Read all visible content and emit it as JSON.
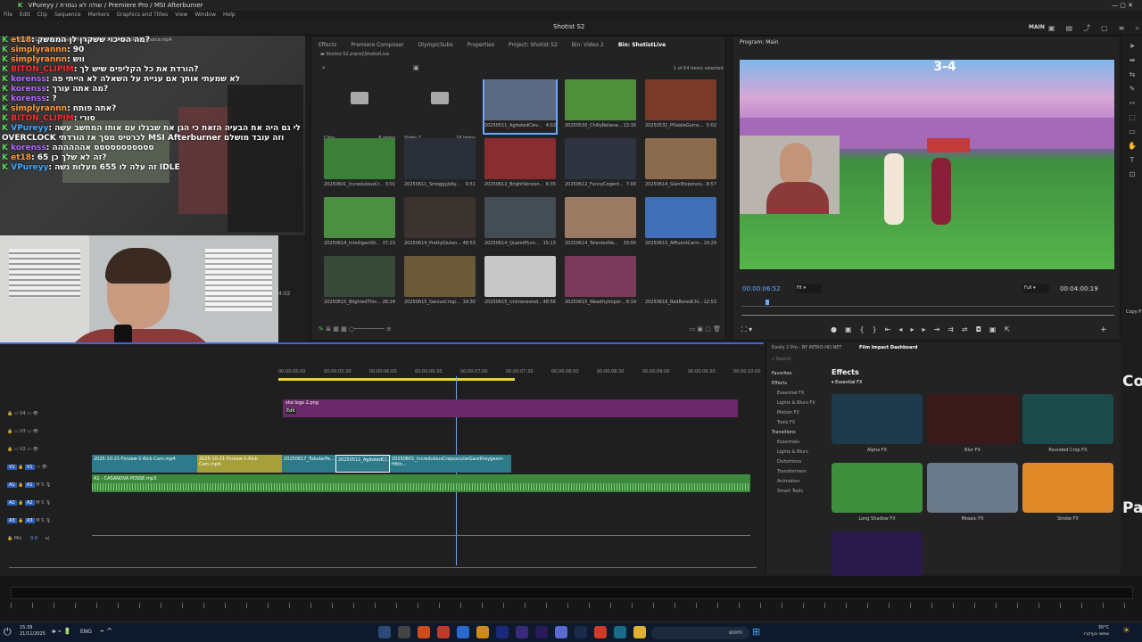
{
  "window": {
    "title": "VPureyy / שולה לא נגמרת / Premiere Pro / MSI Afterburner",
    "sequence_title": "Shotist S2",
    "workspace": "MAIN"
  },
  "menu": [
    "File",
    "Edit",
    "Clip",
    "Sequence",
    "Markers",
    "Graphics and Titles",
    "View",
    "Window",
    "Help"
  ],
  "chat": {
    "header_file": "20250511_AgitatedCleverPiedCWarrior-3i3D9pPLlidRZdt_source.mp4",
    "lines": [
      {
        "user": "et18",
        "text": ": מה הסיכוי ששקרן לן הממשק?",
        "color": "#ff9a3c"
      },
      {
        "user": "simplyrannn",
        "text": ": 90",
        "color": "#ff9a3c"
      },
      {
        "user": "simplyrannn",
        "text": ": ווש",
        "color": "#ff9a3c"
      },
      {
        "user": "BITON_CLIPIM",
        "text": ": הורדת את כל הקליפים שיש לך?",
        "color": "#ff2a2a"
      },
      {
        "user": "korenss",
        "text": ": לא שמעתי אותך אם עניית על השאלה לא הייתי פה",
        "color": "#b36bff"
      },
      {
        "user": "korenss",
        "text": ": מה אתה עורך?",
        "color": "#b36bff"
      },
      {
        "user": "korenss",
        "text": ": ?",
        "color": "#b36bff"
      },
      {
        "user": "simplyrannn",
        "text": ": אתה פותח?",
        "color": "#ff9a3c"
      },
      {
        "user": "BITON_CLIPIM",
        "text": ": סורי",
        "color": "#ff2a2a"
      },
      {
        "user": "VPureyy",
        "text": ": לי גם היה את הבעיה הזאת כי הגן את שבגלו עם אותו המחשב עשה",
        "color": "#3fa9ff"
      },
      {
        "user": "",
        "text": "OVERCLOCK לכרטיס מסך אז הורדתי MSI Afterburner וזה עובד מושלם",
        "color": "#ffffff"
      },
      {
        "user": "korenss",
        "text": ": ססססססססססס אהההההה",
        "color": "#b36bff"
      },
      {
        "user": "et18",
        "text": ": 65 זה לא שלך כן?",
        "color": "#ff9a3c"
      },
      {
        "user": "VPureyy",
        "text": ": זה עלה לו 655 מעלות נשה IDLE",
        "color": "#3fa9ff"
      }
    ]
  },
  "project": {
    "tabs": [
      "Effects",
      "Premiere Composer",
      "OlympicSubs",
      "Properties",
      "Project: Shotist S2",
      "Bin: Video 2",
      "Bin: ShotistLive"
    ],
    "active_tab": "Bin: ShotistLive",
    "path": "Shotist S2.prproj\\ShotistLive",
    "selection_info": "1 of 64 items selected",
    "items": [
      {
        "name": "Clips",
        "dur": "6 items",
        "kind": "folder"
      },
      {
        "name": "Video 2",
        "dur": "16 items",
        "kind": "folder"
      },
      {
        "name": "20250511_AgitatedClev...",
        "dur": "4:02",
        "kind": "clip",
        "color": "#5b6a82"
      },
      {
        "name": "20250530_ChillyRelieve...",
        "dur": "13:16",
        "kind": "clip",
        "color": "#4f8f3a"
      },
      {
        "name": "20250531_PlliableGurns...",
        "dur": "5:02",
        "kind": "clip",
        "color": "#7a3a2a"
      },
      {
        "name": "20250601_IncredulousCr...",
        "dur": "3:01",
        "kind": "clip",
        "color": "#3c7f38"
      },
      {
        "name": "20250611_SmoggyJolly...",
        "dur": "9:51",
        "kind": "clip",
        "color": "#2a2f3a"
      },
      {
        "name": "20250612_BrightVersion...",
        "dur": "6:35",
        "kind": "clip",
        "color": "#8a2d33"
      },
      {
        "name": "20250612_FunnyCogent...",
        "dur": "7:00",
        "kind": "clip",
        "color": "#2e3440"
      },
      {
        "name": "20250614_GiantExpensiv...",
        "dur": "8:57",
        "kind": "clip",
        "color": "#8a6b4e"
      },
      {
        "name": "20250614_IntelligentSt...",
        "dur": "37:23",
        "kind": "clip",
        "color": "#4c8f42"
      },
      {
        "name": "20250614_PrettyGluten...",
        "dur": "48:53",
        "kind": "clip",
        "color": "#3a3330"
      },
      {
        "name": "20250614_QuaintPlum...",
        "dur": "15:13",
        "kind": "clip",
        "color": "#444c55"
      },
      {
        "name": "20250614_TalentedVe...",
        "dur": "33:00",
        "kind": "clip",
        "color": "#9a7a62"
      },
      {
        "name": "20250615_AffluentCarin...",
        "dur": "19:29",
        "kind": "clip",
        "color": "#3f6fb6"
      },
      {
        "name": "20250615_BlightedThin...",
        "dur": "26:24",
        "kind": "clip",
        "color": "#3a4a3a"
      },
      {
        "name": "20250615_GeniusCrisp...",
        "dur": "19:30",
        "kind": "clip",
        "color": "#6a5a3a"
      },
      {
        "name": "20250615_Uninterested...",
        "dur": "48:56",
        "kind": "clip",
        "color": "#c8c8c8"
      },
      {
        "name": "20250615_WealthyImpor...",
        "dur": "8:19",
        "kind": "clip",
        "color": "#7a3a5a"
      },
      {
        "name": "20250616_RedBoredChi...",
        "dur": "12:53",
        "kind": "clip",
        "color": "#222222"
      }
    ]
  },
  "program": {
    "title": "Program: Main",
    "timecode": "00:00:06:52",
    "fit": "Fit",
    "quality": "Full",
    "duration": "00:04:00:19",
    "scoreboard": "3-4"
  },
  "timeline": {
    "ruler": [
      "00:00:05:00",
      "00:00:05:30",
      "00:00:06:00",
      "00:00:06:30",
      "00:00:07:00",
      "00:00:07:30",
      "00:00:08:00",
      "00:00:08:30",
      "00:00:09:00",
      "00:00:09:30",
      "00:00:10:00"
    ],
    "tracks_video": [
      "V4",
      "V3",
      "V2",
      "V1"
    ],
    "tracks_audio": [
      "A1",
      "A2",
      "A3"
    ],
    "mix_label": "Mix",
    "mix_value": "0.0",
    "graphic_clip": "sho logo 2.png",
    "graphic_tag": "Edit",
    "v1_clips": [
      "2025-10-21-Forzaw-1-Kick-Cam.mp4",
      "2025-10-21-Forzaw-1-Kick-Cam.mp4",
      "20250617_TubularPa...",
      "20250511_AgitatedCl...",
      "20250601_IncredulousCrepuscularGaurKreygasm-HItIn..."
    ],
    "a1_clip": "A1 - CASANOVA POSSE.mp3",
    "side_timecode": "4:02"
  },
  "effects_panel": {
    "tabs": [
      "Easily 2 Pro - BY INTRO-HD.NET",
      "Film Impact Dashboard"
    ],
    "search_placeholder": "Search",
    "heading": "Effects",
    "breadcrumb": "Essential FX",
    "sidebar": [
      "Favorites",
      "Effects",
      "Essential FX",
      "Lights & Blurs FX",
      "Motion FX",
      "Tools FX",
      "Transitions",
      "Essentials",
      "Lights & Blurs",
      "Distortions",
      "Transformers",
      "Animation",
      "Smart Tools"
    ],
    "items": [
      {
        "name": "Alpha FX",
        "color": "#1f3a4a"
      },
      {
        "name": "Blur FX",
        "color": "#3a1a1a"
      },
      {
        "name": "Rounded Crop FX",
        "color": "#1d4a4a"
      },
      {
        "name": "Long Shadow FX",
        "color": "#3e8f3e"
      },
      {
        "name": "Mosaic FX",
        "color": "#6a7a8a"
      },
      {
        "name": "Stroke FX",
        "color": "#e08a2a"
      },
      {
        "name": "",
        "color": "#2a1a4a"
      }
    ]
  },
  "overlay_text": {
    "right1": "Co",
    "right2": "Pa",
    "copy": "Copy P"
  },
  "taskbar": {
    "time": "15:39",
    "date": "21/11/2025",
    "lang": "ENG",
    "search_text": "חיפוש",
    "weather_temp": "30°C",
    "weather_desc": "שמשי בעיקרו"
  }
}
